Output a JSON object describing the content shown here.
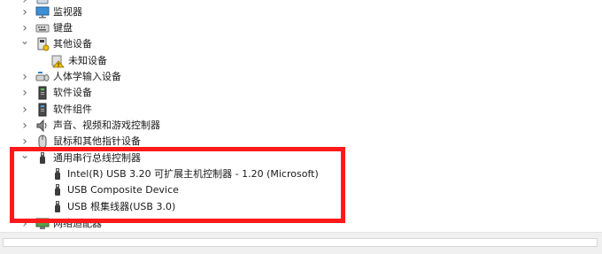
{
  "tree": {
    "items": [
      {
        "label": "监视器",
        "icon": "monitor-icon"
      },
      {
        "label": "键盘",
        "icon": "keyboard-icon"
      },
      {
        "label": "其他设备",
        "icon": "other-devices-icon"
      },
      {
        "label": "未知设备",
        "icon": "unknown-device-warning-icon"
      },
      {
        "label": "人体学输入设备",
        "icon": "hid-icon"
      },
      {
        "label": "软件设备",
        "icon": "software-device-icon"
      },
      {
        "label": "软件组件",
        "icon": "software-component-icon"
      },
      {
        "label": "声音、视频和游戏控制器",
        "icon": "sound-icon"
      },
      {
        "label": "鼠标和其他指针设备",
        "icon": "mouse-icon"
      },
      {
        "label": "通用串行总线控制器",
        "icon": "usb-icon"
      },
      {
        "label": "Intel(R) USB 3.20 可扩展主机控制器 - 1.20 (Microsoft)",
        "icon": "usb-icon"
      },
      {
        "label": "USB Composite Device",
        "icon": "usb-icon"
      },
      {
        "label": "USB 根集线器(USB 3.0)",
        "icon": "usb-icon"
      },
      {
        "label": "网络适配器",
        "icon": "network-adapter-icon"
      }
    ]
  },
  "colors": {
    "highlight": "#ff1a1a",
    "warning": "#f2c200"
  }
}
